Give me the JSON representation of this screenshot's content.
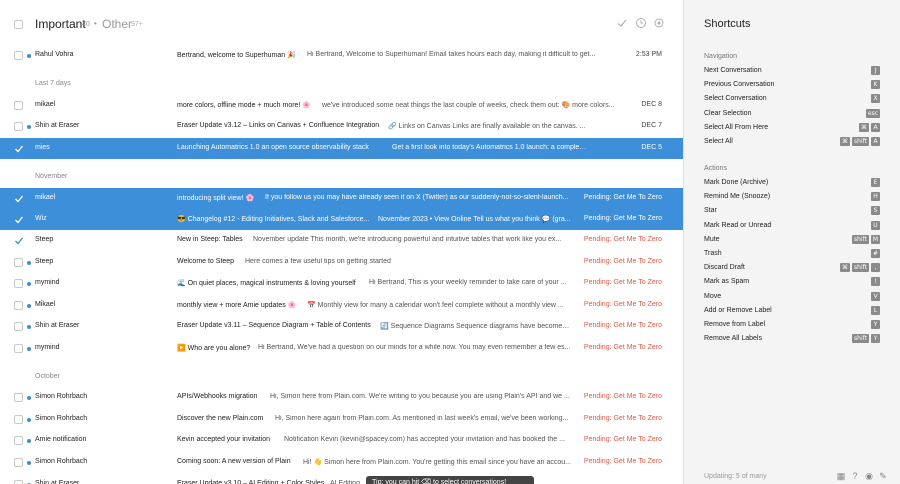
{
  "header": {
    "title": "Important",
    "title_count": "40",
    "bullet": "•",
    "tab2": "Other",
    "tab2_count": "97+"
  },
  "sections": {
    "last7": "Last 7 days",
    "november": "November",
    "october": "October"
  },
  "rows": [
    {
      "sender": "Rahul Vohra",
      "subject": "Bertrand, welcome to Superhuman 🎉",
      "preview": "Hi Bertrand, Welcome to Superhuman! Email takes hours each day, making it difficult to get...",
      "date": "2:53 PM"
    },
    {
      "sender": "mikael",
      "subject": "more colors, offline mode + much more! 🌸",
      "preview": "we've introduced some neat things the last couple of weeks, check them out: 🎨 more colors...",
      "date": "DEC 8"
    },
    {
      "sender": "Shin at Eraser",
      "subject": "Eraser Update v3.12 – Links on Canvas + Confluence Integration",
      "preview": "🔗 Links on Canvas Links are finally available on the canvas. ...",
      "date": "DEC 7"
    },
    {
      "sender": "mies",
      "subject": "Launching Automatrics 1.0 an open source observability stack",
      "preview": "Get a first look into today's Automatrics 1.0 launch: a complete...",
      "date": "DEC 5"
    },
    {
      "sender": "mikael",
      "subject": "introducing split view! 🌸",
      "preview": "If you follow us you may have already seen it on X (Twitter) as our suddenly-not-so-silent-launch...",
      "date": "Pending: Get Me To Zero"
    },
    {
      "sender": "Wiz",
      "subject": "😎 Changelog #12 - Editing Initiatives, Slack and Salesforce...",
      "preview": "November 2023 • View Online Tell us what you think 💬 (gra...",
      "date": "Pending: Get Me To Zero"
    },
    {
      "sender": "Steep",
      "subject": "New in Steep: Tables",
      "preview": "November update This month, we're introducing powerful and intuitive tables that work like you ex...",
      "date": "Pending: Get Me To Zero"
    },
    {
      "sender": "Steep",
      "subject": "Welcome to Steep",
      "preview": "Here comes a few useful tips on getting started",
      "date": "Pending: Get Me To Zero"
    },
    {
      "sender": "mymind",
      "subject": "🌊 On quiet places, magical instruments & loving yourself",
      "preview": "Hi Bertrand, This is your weekly reminder to take care of your ...",
      "date": "Pending: Get Me To Zero"
    },
    {
      "sender": "Mikael",
      "subject": "monthly view + more Amie updates 🌸",
      "preview": "📅 Monthly view for many a calendar won't feel complete without a monthly view ...",
      "date": "Pending: Get Me To Zero"
    },
    {
      "sender": "Shin at Eraser",
      "subject": "Eraser Update v3.11 – Sequence Diagram + Table of Contents",
      "preview": "🔄 Sequence Diagrams Sequence diagrams have become a...",
      "date": "Pending: Get Me To Zero"
    },
    {
      "sender": "mymind",
      "subject": "▶️ Who are you alone?",
      "preview": "Hi Bertrand, We've had a question on our minds for a while now. You may even remember a few es...",
      "date": "Pending: Get Me To Zero"
    },
    {
      "sender": "Simon Rohrbach",
      "subject": "APIs/Webhooks migration",
      "preview": "Hi, Simon here from Plain.com. We're writing to you because you are using Plain's API and we ...",
      "date": "Pending: Get Me To Zero"
    },
    {
      "sender": "Simon Rohrbach",
      "subject": "Discover the new Plain.com",
      "preview": "Hi, Simon here again from Plain.com. As mentioned in last week's email, we've been working...",
      "date": "Pending: Get Me To Zero"
    },
    {
      "sender": "Amie notification",
      "subject": "Kevin accepted your invitation",
      "preview": "Notification Kevin (kevin@spacey.com) has accepted your invitation and has booked the ...",
      "date": "Pending: Get Me To Zero"
    },
    {
      "sender": "Simon Rohrbach",
      "subject": "Coming soon: A new version of Plain",
      "preview": "Hi! 👋 Simon here from Plain.com. You're getting this email since you have an accou...",
      "date": "Pending: Get Me To Zero"
    },
    {
      "sender": "Shin at Eraser",
      "subject": "Eraser Update v3.10 – AI Editing + Color Styles",
      "preview": "AI Editing ...",
      "date": ""
    }
  ],
  "tooltip": "Tip: you can hit ⌫ to select conversations!",
  "shortcuts": {
    "title": "Shortcuts",
    "navigation_label": "Navigation",
    "actions_label": "Actions",
    "navigation": [
      {
        "label": "Next Conversation",
        "keys": [
          "J"
        ]
      },
      {
        "label": "Previous Conversation",
        "keys": [
          "K"
        ]
      },
      {
        "label": "Select Conversation",
        "keys": [
          "X"
        ]
      },
      {
        "label": "Clear Selection",
        "keys": [
          "esc"
        ]
      },
      {
        "label": "Select All From Here",
        "keys": [
          "⌘",
          "A"
        ]
      },
      {
        "label": "Select All",
        "keys": [
          "⌘",
          "shift",
          "A"
        ]
      }
    ],
    "actions": [
      {
        "label": "Mark Done (Archive)",
        "keys": [
          "E"
        ]
      },
      {
        "label": "Remind Me (Snooze)",
        "keys": [
          "H"
        ]
      },
      {
        "label": "Star",
        "keys": [
          "S"
        ]
      },
      {
        "label": "Mark Read or Unread",
        "keys": [
          "U"
        ]
      },
      {
        "label": "Mute",
        "keys": [
          "shift",
          "M"
        ]
      },
      {
        "label": "Trash",
        "keys": [
          "#"
        ]
      },
      {
        "label": "Discard Draft",
        "keys": [
          "⌘",
          "shift",
          ","
        ]
      },
      {
        "label": "Mark as Spam",
        "keys": [
          "!"
        ]
      },
      {
        "label": "Move",
        "keys": [
          "V"
        ]
      },
      {
        "label": "Add or Remove Label",
        "keys": [
          "L"
        ]
      },
      {
        "label": "Remove from Label",
        "keys": [
          "Y"
        ]
      },
      {
        "label": "Remove All Labels",
        "keys": [
          "shift",
          "Y"
        ]
      }
    ],
    "status": "Updating: 5 of many"
  },
  "colors": {
    "accent": "#3d8fd9",
    "pending": "#e05a47"
  }
}
